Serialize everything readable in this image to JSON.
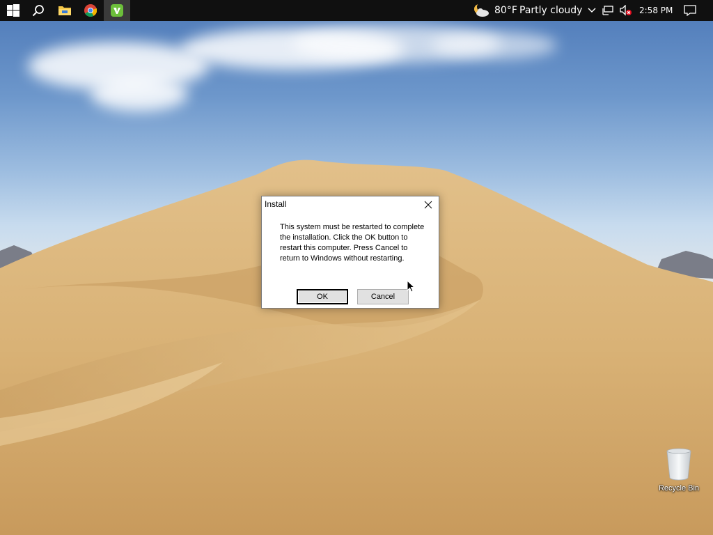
{
  "taskbar": {
    "start_icon": "windows-logo-icon",
    "search_icon": "search-icon",
    "apps": [
      {
        "name": "file-explorer",
        "icon": "folder-icon"
      },
      {
        "name": "google-chrome",
        "icon": "chrome-icon"
      },
      {
        "name": "installer",
        "icon": "installer-app-icon",
        "active": true
      }
    ],
    "weather": {
      "icon": "partly-cloudy-moon-icon",
      "temperature": "80°F",
      "condition": "Partly cloudy"
    },
    "tray": {
      "chevron_icon": "chevron-up-icon",
      "network_icon": "network-icon",
      "volume_icon": "volume-muted-icon"
    },
    "clock": "2:58 PM",
    "notification_icon": "notification-icon"
  },
  "dialog": {
    "title": "Install",
    "message": "This system must be restarted to complete the installation. Click the OK button to restart this computer. Press Cancel to return to Windows without restarting.",
    "ok_label": "OK",
    "cancel_label": "Cancel",
    "close_icon": "close-icon"
  },
  "desktop": {
    "icons": [
      {
        "label": "Recycle Bin",
        "icon": "recycle-bin-icon"
      }
    ]
  },
  "colors": {
    "taskbar_bg": "#101010",
    "sky_top": "#4d79b8",
    "sand": "#d8b174",
    "dialog_bg": "#ffffff"
  }
}
